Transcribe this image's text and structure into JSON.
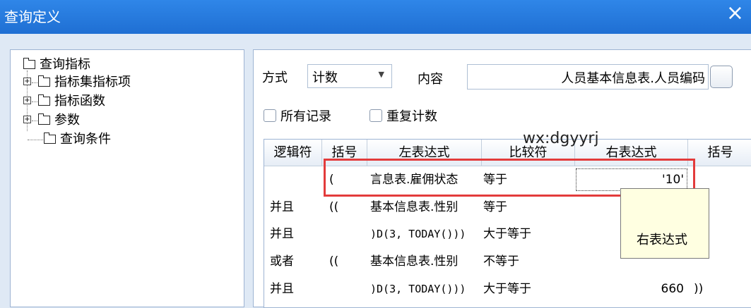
{
  "window": {
    "title": "查询定义",
    "close_glyph": "×"
  },
  "tree": {
    "root": "查询指标",
    "children": [
      {
        "label": "指标集指标项",
        "expand_glyph": "+"
      },
      {
        "label": "指标函数",
        "expand_glyph": "+"
      },
      {
        "label": "参数",
        "expand_glyph": "+"
      },
      {
        "label": "查询条件"
      }
    ]
  },
  "form": {
    "method_label": "方式",
    "method_value": "计数",
    "content_label": "内容",
    "content_value": "人员基本信息表.人员编码",
    "all_records_label": "所有记录",
    "repeat_count_label": "重复计数"
  },
  "grid": {
    "headers": [
      "逻辑符",
      "括号",
      "左表达式",
      "比较符",
      "右表达式",
      "括号"
    ],
    "rows": [
      {
        "logic": "",
        "open": "(",
        "left": "言息表.雇佣状态",
        "op": "等于",
        "right": "'10'",
        "close": ""
      },
      {
        "logic": "并且",
        "open": "((",
        "left": "基本信息表.性别",
        "op": "等于",
        "right": "",
        "close": ""
      },
      {
        "logic": "并且",
        "open": "",
        "left": ")D(3, TODAY()))",
        "op": "大于等于",
        "right": "",
        "close": ""
      },
      {
        "logic": "或者",
        "open": "((",
        "left": "基本信息表.性别",
        "op": "不等于",
        "right": "",
        "close": ""
      },
      {
        "logic": "并且",
        "open": "",
        "left": ")D(3, TODAY()))",
        "op": "大于等于",
        "right": "660",
        "close": "))"
      }
    ]
  },
  "tooltip": {
    "text": "右表达式"
  },
  "watermark": "wx:dgyyrj",
  "colors": {
    "titlebar": "#2379df",
    "highlight": "#e33b3b",
    "tooltip_bg": "#ffffe1"
  }
}
